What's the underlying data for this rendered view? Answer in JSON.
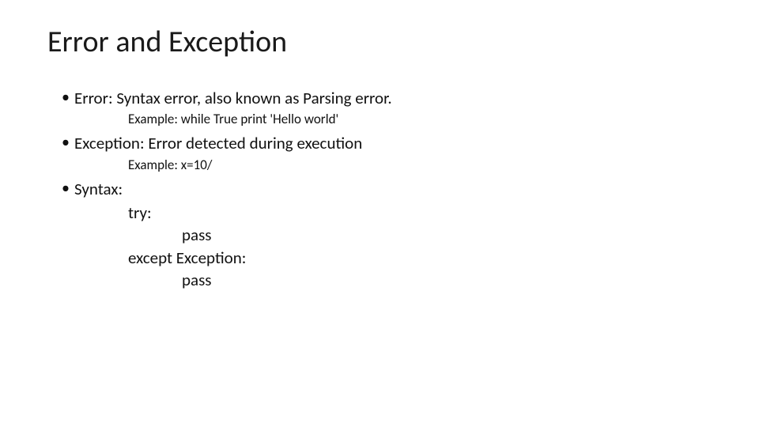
{
  "title": "Error and Exception",
  "bullets": {
    "b1": "Error: Syntax error,  also known as Parsing error.",
    "b1_example": "Example:  while True print 'Hello world'",
    "b2": "Exception:  Error detected during execution",
    "b2_example": "Example:  x=10/",
    "b3": "Syntax:"
  },
  "code": {
    "line1": "try:",
    "line2": "pass",
    "line3": "except Exception:",
    "line4": "pass"
  }
}
